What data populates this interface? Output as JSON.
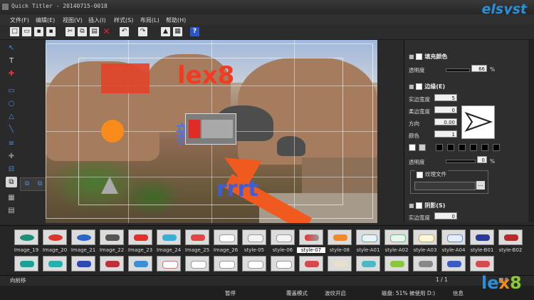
{
  "app": {
    "title": "Quick Titler - 20140715-0018",
    "logo": "elsyst"
  },
  "menu": [
    "文件(F)",
    "编辑(E)",
    "视图(V)",
    "插入(I)",
    "样式(S)",
    "布局(L)",
    "帮助(H)"
  ],
  "canvas": {
    "text1": "lex8",
    "text2": "rrrt",
    "text3": "新吧"
  },
  "panel": {
    "fill_color": "填充颜色",
    "opacity_label": "透明度",
    "opacity_value": "66",
    "pct": "%",
    "edge": "边缘(E)",
    "solid_width_label": "实边宽度",
    "solid_width_value": "5",
    "soft_width_label": "柔边宽度",
    "soft_width_value": "0",
    "direction_label": "方向",
    "direction_value": "0.00",
    "color_label": "颜色",
    "color_value": "1",
    "edge_opacity_label": "透明度",
    "edge_opacity_value": "0",
    "texture_file": "纹理文件",
    "shadow": "阴影(S)",
    "shadow_width_label": "实边宽度",
    "shadow_width_value": "0"
  },
  "gallery": {
    "labels": [
      "Image_19",
      "Image_20",
      "Image_21",
      "Image_22",
      "Image_23",
      "Image_24",
      "Image_25",
      "Image_26",
      "style-05",
      "style-06",
      "style-07",
      "style-08",
      "style-A01",
      "style-A02",
      "style-A03",
      "style-A04",
      "style-B01",
      "style-B02"
    ]
  },
  "status": {
    "hint": "向前移",
    "page": "1 / 1",
    "more": "更多",
    "pause": "暂停",
    "overwrite": "覆盖模式",
    "anti": "波纹开启",
    "disk": "磁盘: 51% 被使用 D:)",
    "info": "信息"
  },
  "colors": {
    "accent": "#2a8fd6",
    "orange": "#f05a1e"
  }
}
